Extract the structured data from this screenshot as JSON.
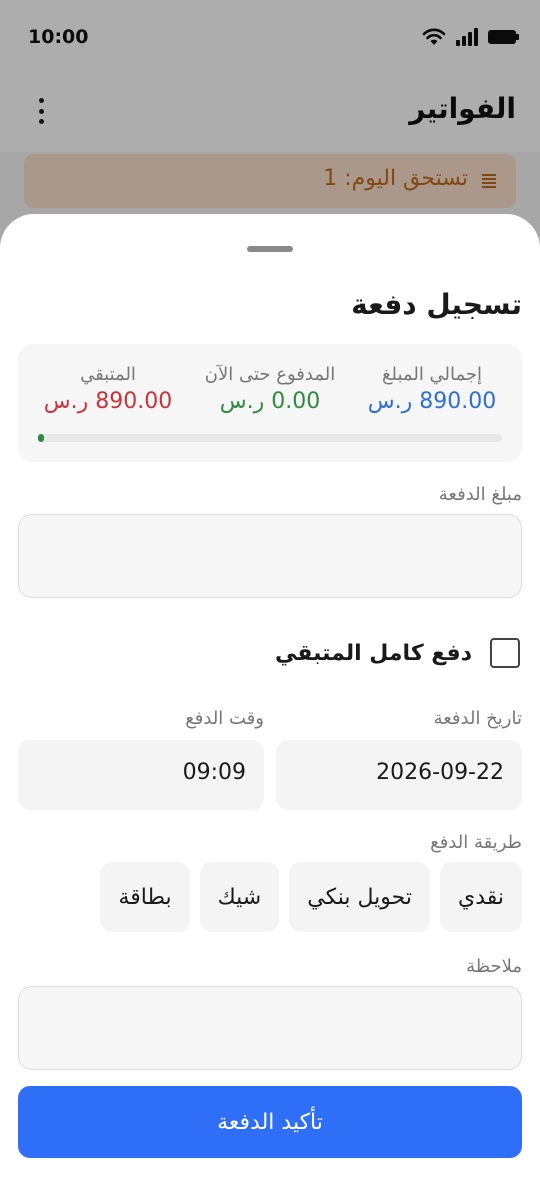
{
  "status_bar": {
    "time": "10:00"
  },
  "app_bar": {
    "title": "الفواتير"
  },
  "due_banner": {
    "text": "تستحق اليوم: 1"
  },
  "sheet": {
    "title": "تسجيل دفعة",
    "summary": {
      "total_label": "إجمالي المبلغ",
      "total_value": "890.00 ر.س",
      "paid_label": "المدفوع حتى الآن",
      "paid_value": "0.00 ر.س",
      "remaining_label": "المتبقي",
      "remaining_value": "890.00 ر.س",
      "paid_fraction": 0.0
    },
    "amount": {
      "label": "مبلغ الدفعة",
      "value": ""
    },
    "pay_full": {
      "label": "دفع كامل المتبقي",
      "checked": false
    },
    "date": {
      "label": "تاريخ الدفعة",
      "value": "2026-09-22"
    },
    "time": {
      "label": "وقت الدفع",
      "value": "09:09"
    },
    "method": {
      "label": "طريقة الدفع",
      "options": [
        "نقدي",
        "تحويل بنكي",
        "شيك",
        "بطاقة"
      ]
    },
    "note": {
      "label": "ملاحظة",
      "value": ""
    },
    "confirm_label": "تأكيد الدفعة"
  },
  "colors": {
    "total": "#2f6fd0",
    "paid": "#2e8b3d",
    "remaining": "#c9343a",
    "primary": "#2f6ef6",
    "due": "#c26a1c"
  }
}
